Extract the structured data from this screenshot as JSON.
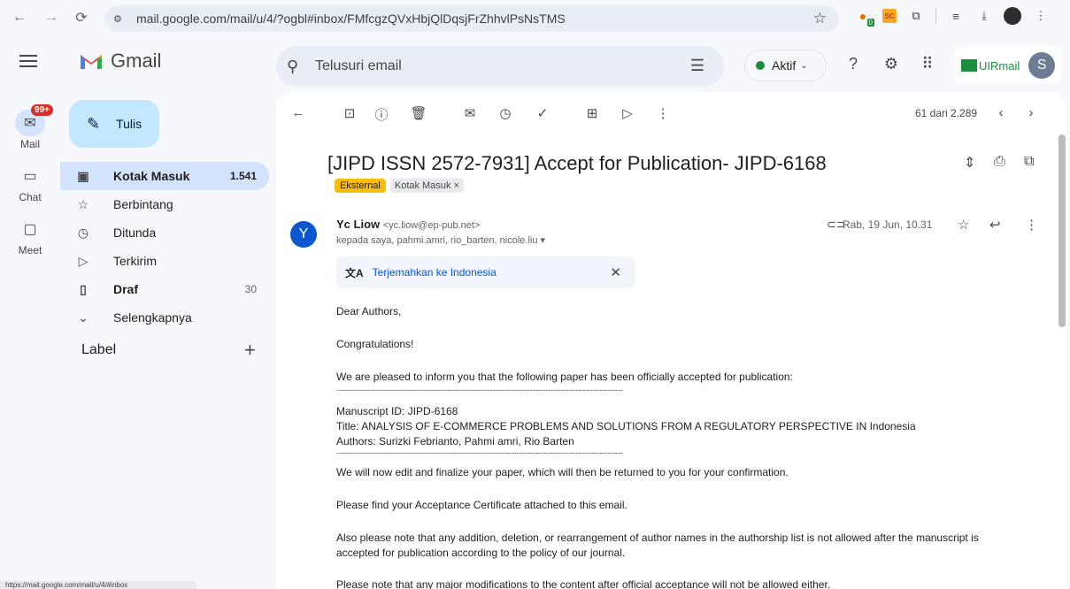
{
  "browser": {
    "url": "mail.google.com/mail/u/4/?ogbl#inbox/FMfcgzQVxHbjQlDqsjFrZhhvlPsNsTMS",
    "ext_badge": "0",
    "ext_sc": "SC"
  },
  "header": {
    "app_name": "Gmail",
    "search_placeholder": "Telusuri email",
    "status_label": "Aktif",
    "account_brand": "UIRmail",
    "avatar_letter": "S"
  },
  "rail": [
    {
      "label": "Mail",
      "badge": "99+"
    },
    {
      "label": "Chat"
    },
    {
      "label": "Meet"
    }
  ],
  "nav": {
    "compose_label": "Tulis",
    "items": [
      {
        "label": "Kotak Masuk",
        "count": "1.541"
      },
      {
        "label": "Berbintang",
        "count": ""
      },
      {
        "label": "Ditunda",
        "count": ""
      },
      {
        "label": "Terkirim",
        "count": ""
      },
      {
        "label": "Draf",
        "count": "30"
      },
      {
        "label": "Selengkapnya",
        "count": ""
      }
    ],
    "labels_heading": "Label"
  },
  "toolbar": {
    "pager": "61 dari 2.289"
  },
  "email": {
    "subject": "[JIPD ISSN 2572-7931] Accept for Publication- JIPD-6168",
    "tags": [
      "Eksternal",
      "Kotak Masuk ×"
    ],
    "sender_initial": "Y",
    "sender_name": "Yc Liow",
    "sender_email": "<yc.liow@ep-pub.net>",
    "recipients": "kepada saya, pahmi.amri, rio_barten, nicole.liu ▾",
    "date": "Rab, 19 Jun, 10.31",
    "translate_label": "Terjemahkan ke Indonesia",
    "body": {
      "greeting": "Dear Authors,",
      "congrats": "Congratulations!",
      "intro": "We are pleased to inform you that the following paper has been officially accepted for publication:",
      "rule": "------------------------------------------------------------------------------------------------------------",
      "manuscript": "Manuscript ID: JIPD-6168",
      "title": "Title: ANALYSIS OF E-COMMERCE PROBLEMS AND SOLUTIONS FROM A REGULATORY PERSPECTIVE IN Indonesia",
      "authors": "Authors: Surizki Febrianto, Pahmi amri, Rio Barten",
      "edit": "We will now edit and finalize your paper, which will then be returned to you for your confirmation.",
      "certificate": "Please find your Acceptance Certificate attached to this email.",
      "note_line1": "Also please note that any addition, deletion, or rearrangement of author names in the authorship list is not allowed after the manuscript is",
      "note_line2": "accepted for publication according to the policy of our journal.",
      "cut_line": "Please note that any major modifications to the content after official acceptance will not be allowed either."
    }
  },
  "status_bar_url": "https://mail.google.com/mail/u/4/#inbox"
}
